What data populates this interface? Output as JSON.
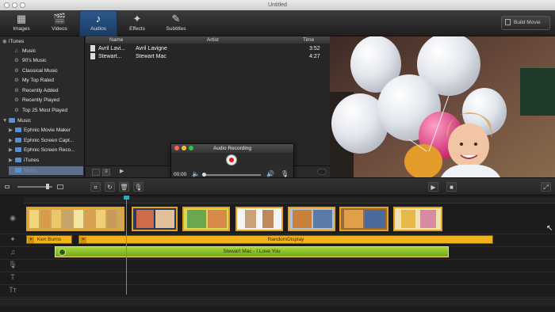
{
  "window": {
    "title": "Untitled"
  },
  "toolbar": {
    "tabs": [
      {
        "label": "Images",
        "icon": "images-icon",
        "glyph": "▦"
      },
      {
        "label": "Videos",
        "icon": "clapper-icon",
        "glyph": "🎬"
      },
      {
        "label": "Audios",
        "icon": "music-note-icon",
        "glyph": "♪",
        "active": true
      },
      {
        "label": "Effects",
        "icon": "magic-wand-icon",
        "glyph": "✦"
      },
      {
        "label": "Subtitles",
        "icon": "pencil-icon",
        "glyph": "✎"
      }
    ],
    "build_label": "Build Movie"
  },
  "sidebar": {
    "items": [
      {
        "label": "iTunes",
        "kind": "root"
      },
      {
        "label": "Music",
        "kind": "child"
      },
      {
        "label": "90's Music",
        "kind": "child"
      },
      {
        "label": "Classical Music",
        "kind": "child"
      },
      {
        "label": "My Top Rated",
        "kind": "child"
      },
      {
        "label": "Recently Added",
        "kind": "child"
      },
      {
        "label": "Recently Played",
        "kind": "child"
      },
      {
        "label": "Top 25 Most Played",
        "kind": "child"
      },
      {
        "label": "Music",
        "kind": "root"
      },
      {
        "label": "Ephnic Movie Maker",
        "kind": "folder"
      },
      {
        "label": "Ephnic Screen Capt...",
        "kind": "folder"
      },
      {
        "label": "Ephnic Screen Reco...",
        "kind": "folder"
      },
      {
        "label": "iTunes",
        "kind": "folder"
      },
      {
        "label": "Music",
        "kind": "folder",
        "selected": true
      }
    ]
  },
  "audio_list": {
    "columns": [
      "Name",
      "Artist",
      "Time"
    ],
    "rows": [
      {
        "name": "Avril Lavi...",
        "artist": "Avril Lavigne",
        "time": "3:52"
      },
      {
        "name": "Stewart...",
        "artist": "Stewart Mac",
        "time": "4:27"
      }
    ]
  },
  "recording_dialog": {
    "title": "Audio Recording",
    "timer": "00:00"
  },
  "timeline": {
    "image_track_clips": 8,
    "effect_clips": [
      {
        "label": "Ken Burns"
      },
      {
        "label": "RandomDisplay"
      }
    ],
    "audio_clip": {
      "label": "Stewart Mac - I Love You"
    }
  },
  "colors": {
    "accent_tab": "#2c5a8c",
    "clip_border": "#e7a21c",
    "effect_bar": "#f2b21c",
    "audio_bar": "#8ac51e",
    "playhead": "#1fb0c7"
  }
}
